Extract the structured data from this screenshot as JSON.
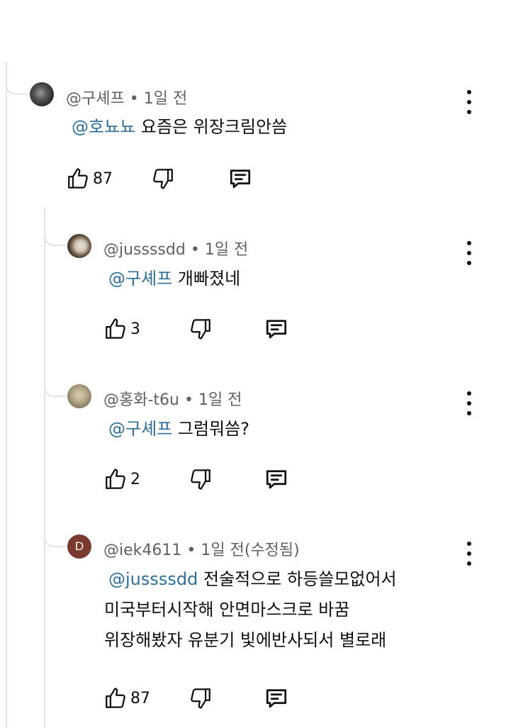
{
  "comments": [
    {
      "author": "@구셰프",
      "separator": "•",
      "time": "1일 전",
      "edited": "",
      "mention": "@호뇨뇨",
      "lines": [
        "요즘은 위장크림안씀"
      ],
      "likes": "87",
      "avatar_letter": ""
    },
    {
      "author": "@jussssdd",
      "separator": "•",
      "time": "1일 전",
      "edited": "",
      "mention": "@구셰프",
      "lines": [
        "개빠졌네"
      ],
      "likes": "3",
      "avatar_letter": ""
    },
    {
      "author": "@홍화-t6u",
      "separator": "•",
      "time": "1일 전",
      "edited": "",
      "mention": "@구셰프",
      "lines": [
        "그럼뭐씀?"
      ],
      "likes": "2",
      "avatar_letter": ""
    },
    {
      "author": "@iek4611",
      "separator": "•",
      "time": "1일 전",
      "edited": "(수정됨)",
      "mention": "@jussssdd",
      "lines": [
        "전술적으로 하등쓸모없어서",
        "미국부터시작해 안면마스크로 바꿈",
        "위장해봤자 유분기 빛에반사되서 별로래"
      ],
      "likes": "87",
      "avatar_letter": "D"
    }
  ],
  "icons": {
    "like": "thumbs-up-icon",
    "dislike": "thumbs-down-icon",
    "reply": "reply-icon",
    "menu": "more-vert-icon"
  },
  "colors": {
    "mention": "#2d6f99",
    "meta": "#606060",
    "thread_line": "#e4e4e4",
    "avatar_d": "#7a3a30"
  }
}
